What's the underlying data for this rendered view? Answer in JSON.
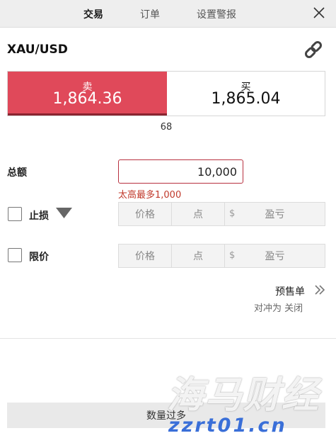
{
  "header": {
    "tabs": [
      {
        "label": "交易",
        "active": true
      },
      {
        "label": "订单",
        "active": false
      },
      {
        "label": "设置警报",
        "active": false
      }
    ],
    "close_icon": "close-icon"
  },
  "instrument": {
    "symbol": "XAU/USD",
    "link_icon": "link-icon"
  },
  "quote": {
    "sell": {
      "label": "卖",
      "price": "1,864.36",
      "color": "#e0495a"
    },
    "buy": {
      "label": "买",
      "price": "1,865.04"
    },
    "spread": "68"
  },
  "amount": {
    "label": "总额",
    "value": "10,000",
    "error": "太高最多1,000",
    "error_color": "#c0392b"
  },
  "stop_loss": {
    "label": "止损",
    "dropdown_icon": "caret-down-icon",
    "fields": {
      "price": "价格",
      "points": "点",
      "currency": "$",
      "pnl": "盈亏"
    }
  },
  "limit": {
    "label": "限价",
    "fields": {
      "price": "价格",
      "points": "点",
      "currency": "$",
      "pnl": "盈亏"
    }
  },
  "presell": {
    "label": "预售单",
    "icon": "double-chevron-right-icon",
    "hedge_text": "对冲为 关闭"
  },
  "submit": {
    "label": "数量过多"
  },
  "watermark": {
    "main": "海马财经",
    "sub": "zzrt01.cn",
    "sub_color": "#3a6fd8"
  }
}
